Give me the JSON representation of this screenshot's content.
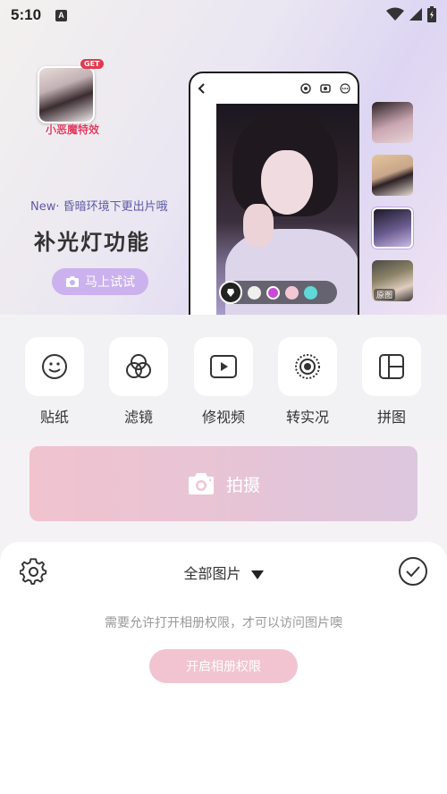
{
  "status_bar": {
    "time": "5:10",
    "notification_icon": "A"
  },
  "banner": {
    "sticker_badge": {
      "tag": "GET",
      "label": "小恶魔特效"
    },
    "subtitle": "New· 昏暗环境下更出片哦",
    "title": "补光灯功能",
    "try_button": "马上试试",
    "thumbnail_label": "原图",
    "filter_colors": [
      "#f1efee",
      "#c94ad7",
      "#f3c7d3",
      "#5fd9d8"
    ]
  },
  "tools": [
    {
      "label": "贴纸",
      "icon": "sticker-smile-icon"
    },
    {
      "label": "滤镜",
      "icon": "filter-circles-icon"
    },
    {
      "label": "修视频",
      "icon": "video-edit-icon"
    },
    {
      "label": "转实况",
      "icon": "live-photo-icon"
    },
    {
      "label": "拼图",
      "icon": "collage-icon"
    }
  ],
  "shoot_button": {
    "label": "拍摄"
  },
  "gallery": {
    "title": "全部图片",
    "permission_message": "需要允许打开相册权限，才可以访问图片噢",
    "permission_button": "开启相册权限"
  },
  "colors": {
    "accent_pink": "#f2c4d1",
    "promo_purple": "#cbb2ee"
  }
}
